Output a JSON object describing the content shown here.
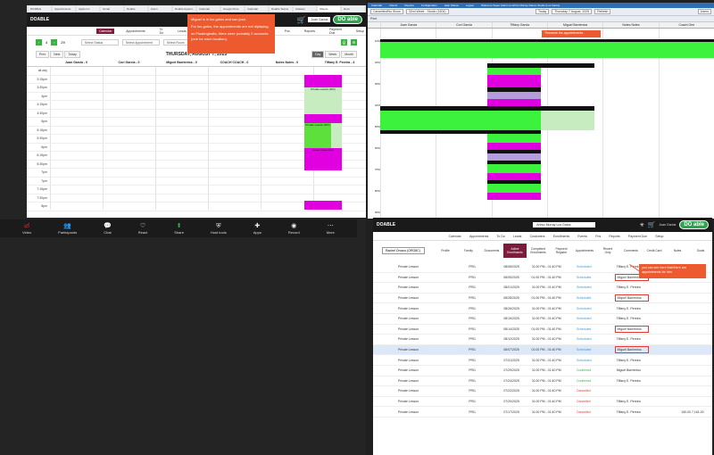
{
  "left": {
    "browser_tabs": [
      "DOABLE",
      "Appointments",
      "Apple Inc",
      "Gmail",
      "Doable",
      "Zoom",
      "Doable Appoin...",
      "Calendar",
      "Google Drive",
      "Calendar",
      "Doable Teams",
      "Classes",
      "Sheets",
      "Docs"
    ],
    "app": {
      "brand": "DOABLE",
      "user": "Juan Garcia",
      "logo": "DO able",
      "nav": [
        "Calendar",
        "Appointments",
        "To Do",
        "Leads",
        "Customers",
        "Enrollments",
        "Events",
        "Pos",
        "Reports",
        "Payment Due",
        "Setup"
      ],
      "controls": {
        "n1": "4",
        "n2": "29",
        "status_placeholder": "Select Status",
        "appointment_placeholder": "Select Appointment",
        "room_placeholder": "Select Room",
        "prev": "Prev",
        "next": "Next",
        "today": "Today",
        "day": "Day",
        "week": "Week",
        "month": "Month",
        "date_title": "THURSDAY, AUGUST 7, 2025"
      },
      "columns": [
        "Juan Garcia - 0",
        "Cori Garcia - 0",
        "Miguel Barrientos - 0",
        "COACH COACH - 0",
        "Notes Notes - 0",
        "Tiffany E. Pereira - 4"
      ],
      "times": [
        "all-day",
        "3:15pm",
        "3:30pm",
        "4pm",
        "4:15pm",
        "4:30pm",
        "5pm",
        "5:15pm",
        "5:30pm",
        "6pm",
        "6:15pm",
        "6:30pm",
        "7pm",
        "7pm",
        "7:15pm",
        "7:30pm",
        "8pm"
      ],
      "appointments": [
        {
          "text": "Private Lesson (DO)"
        },
        {
          "text": "Private Lesson (DO)"
        },
        {
          "text": "Group Class (DO)"
        },
        {
          "text": "Private Lesson (DO)"
        },
        {
          "text": "Group Class (DO)"
        }
      ]
    },
    "callout": {
      "lines": [
        "Miguel is in los gatos and san jose.",
        "For los gatos, the appointments are not diplaying.",
        "on Floatingtraits, there were probably 2 accounts (one for each location)."
      ]
    },
    "zoom": {
      "video": "Video",
      "participants": "Participants",
      "participants_count": "2",
      "chat": "Chat",
      "react": "React",
      "share": "Share",
      "host_tools": "Host tools",
      "apps": "Apps",
      "record": "Record",
      "more": "More"
    }
  },
  "right_top": {
    "menu": [
      "Calendar",
      "Clients",
      "Reports",
      "Configuration",
      "Help Videos",
      "Logout",
      "Welcome Super Admin to Arthur Murray Dance Studio (Los Gatos)"
    ],
    "toolbar": {
      "view_select": "Cancelled/No Show",
      "studio": "32nd Week - Studio (1504)",
      "today": "Today",
      "date": "Thursday 7 August, 2025",
      "refresh": "Refresh",
      "user": "Users",
      "print": "Print"
    },
    "columns": [
      "Juan Garcia",
      "Cori Garcia",
      "Tiffany Garcia",
      "Miguel Barrientos",
      "Notes Notes",
      "Coach One"
    ],
    "hours": [
      "1PM",
      "2PM",
      "3PM",
      "4PM",
      "5PM",
      "6PM",
      "7PM",
      "8PM",
      "9PM"
    ],
    "callout": "Thesesre his appointments."
  },
  "right_bottom": {
    "brand": "DOABLE",
    "search": "Arthur Murray Los Gatos",
    "user": "Juan Garcia",
    "logo": "DO able",
    "nav": [
      "Calendar",
      "Appointments",
      "To Do",
      "Leads",
      "Customers",
      "Enrollments",
      "Events",
      "Pos",
      "Reports",
      "Payment Due",
      "Setup"
    ],
    "location": "Rachel Orozco (ORO8C)",
    "tabs": [
      "Profile",
      "Family",
      "Documents",
      "Active Enrollments",
      "Completed Enrollments",
      "Payment Register",
      "Appointments",
      "Recent Only",
      "Comments",
      "Credit Card",
      "Notes",
      "Goals"
    ],
    "callout": "you can see here that there are appointments for him.",
    "rows": [
      {
        "name": "Private Lesson",
        "code": "PRI1",
        "date": "08/08/2025",
        "time": "01:00 PM - 01:40 PM",
        "status": "Scheduled",
        "st": "enr",
        "teacher": "Tiffany E. Pereira",
        "boxed": false,
        "extra": ""
      },
      {
        "name": "Private Lesson",
        "code": "PRI1",
        "date": "08/05/2025",
        "time": "01:00 PM - 01:40 PM",
        "status": "Scheduled",
        "st": "enr",
        "teacher": "Miguel Barrientos",
        "boxed": true,
        "extra": ""
      },
      {
        "name": "Private Lesson",
        "code": "PRI1",
        "date": "08/01/2025",
        "time": "01:00 PM - 01:40 PM",
        "status": "Scheduled",
        "st": "enr",
        "teacher": "Tiffany E. Pereira",
        "boxed": false,
        "extra": ""
      },
      {
        "name": "Private Lesson",
        "code": "PRI1",
        "date": "08/28/2025",
        "time": "01:00 PM - 01:40 PM",
        "status": "Scheduled",
        "st": "enr",
        "teacher": "Miguel Barrientos",
        "boxed": true,
        "extra": ""
      },
      {
        "name": "Private Lesson",
        "code": "PRI1",
        "date": "08/26/2025",
        "time": "01:00 PM - 01:40 PM",
        "status": "Scheduled",
        "st": "enr",
        "teacher": "Tiffany E. Pereira",
        "boxed": false,
        "extra": ""
      },
      {
        "name": "Private Lesson",
        "code": "PRI1",
        "date": "08/19/2025",
        "time": "01:00 PM - 01:40 PM",
        "status": "Scheduled",
        "st": "enr",
        "teacher": "Tiffany E. Pereira",
        "boxed": false,
        "extra": ""
      },
      {
        "name": "Private Lesson",
        "code": "PRI1",
        "date": "08/14/2025",
        "time": "01:00 PM - 01:40 PM",
        "status": "Scheduled",
        "st": "enr",
        "teacher": "Miguel Barrientos",
        "boxed": true,
        "extra": ""
      },
      {
        "name": "Private Lesson",
        "code": "PRI1",
        "date": "08/12/2025",
        "time": "01:00 PM - 01:40 PM",
        "status": "Scheduled",
        "st": "enr",
        "teacher": "Tiffany E. Pereira",
        "boxed": false,
        "extra": ""
      },
      {
        "name": "Private Lesson",
        "code": "PRI1",
        "date": "08/07/2025",
        "time": "01:00 PM - 01:40 PM",
        "status": "Scheduled",
        "st": "enr",
        "teacher": "Miguel Barrientos",
        "boxed": true,
        "extra": "",
        "sel": true
      },
      {
        "name": "Private Lesson",
        "code": "PRI1",
        "date": "07/31/2025",
        "time": "01:00 PM - 01:40 PM",
        "status": "Scheduled",
        "st": "enr",
        "teacher": "Tiffany E. Pereira",
        "boxed": false,
        "extra": ""
      },
      {
        "name": "Private Lesson",
        "code": "PRI1",
        "date": "07/29/2025",
        "time": "01:00 PM - 01:40 PM",
        "status": "Confirmed",
        "st": "cnf",
        "teacher": "Miguel Barrientos",
        "boxed": false,
        "extra": ""
      },
      {
        "name": "Private Lesson",
        "code": "PRI1",
        "date": "07/24/2025",
        "time": "01:00 PM - 01:40 PM",
        "status": "Confirmed",
        "st": "cnf",
        "teacher": "Tiffany E. Pereira",
        "boxed": false,
        "extra": ""
      },
      {
        "name": "Private Lesson",
        "code": "PRI1",
        "date": "07/22/2025",
        "time": "01:00 PM - 01:40 PM",
        "status": "Cancelled",
        "st": "can",
        "teacher": "",
        "boxed": false,
        "extra": ""
      },
      {
        "name": "Private Lesson",
        "code": "PRI1",
        "date": "07/20/2025",
        "time": "01:00 PM - 01:40 PM",
        "status": "Cancelled",
        "st": "can",
        "teacher": "Tiffany E. Pereira",
        "boxed": false,
        "extra": ""
      },
      {
        "name": "Private Lesson",
        "code": "PRI1",
        "date": "07/17/2025",
        "time": "01:00 PM - 01:40 PM",
        "status": "Cancelled",
        "st": "can",
        "teacher": "Tiffany E. Pereira",
        "boxed": false,
        "extra": "150.00      7,161.00"
      }
    ]
  }
}
